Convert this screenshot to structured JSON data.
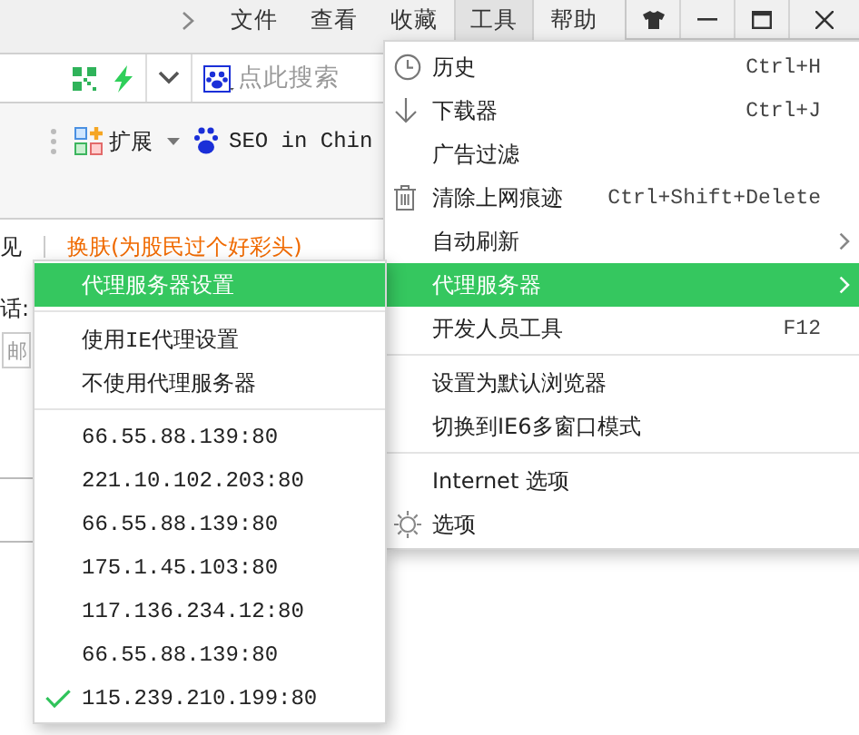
{
  "menu_bar": {
    "items": [
      {
        "label": "文件",
        "selected": false
      },
      {
        "label": "查看",
        "selected": false
      },
      {
        "label": "收藏",
        "selected": false
      },
      {
        "label": "工具",
        "selected": true
      },
      {
        "label": "帮助",
        "selected": false
      }
    ]
  },
  "address_bar": {
    "search_placeholder": "点此搜索"
  },
  "toolbar": {
    "items": [
      {
        "label": "扩展"
      },
      {
        "label": "SEO in Chin"
      }
    ]
  },
  "page": {
    "link": "换肤(为股民过个好彩头)",
    "texts": [
      "见",
      "话:"
    ],
    "field_value": "邮"
  },
  "tools_menu": {
    "items": [
      {
        "kind": "item",
        "label": "历史",
        "shortcut": "Ctrl+H",
        "selected": false
      },
      {
        "kind": "item",
        "label": "下载器",
        "shortcut": "Ctrl+J",
        "selected": false
      },
      {
        "kind": "item",
        "label": "广告过滤",
        "selected": false
      },
      {
        "kind": "item",
        "label": "清除上网痕迹",
        "shortcut": "Ctrl+Shift+Delete",
        "selected": false
      },
      {
        "kind": "item",
        "label": "自动刷新",
        "has_submenu": true,
        "selected": false
      },
      {
        "kind": "item",
        "label": "代理服务器",
        "has_submenu": true,
        "selected": true
      },
      {
        "kind": "item",
        "label": "开发人员工具",
        "shortcut": "F12",
        "selected": false
      },
      {
        "kind": "separator"
      },
      {
        "kind": "item",
        "label": "设置为默认浏览器",
        "selected": false
      },
      {
        "kind": "item",
        "label": "切换到IE6多窗口模式",
        "selected": false
      },
      {
        "kind": "separator"
      },
      {
        "kind": "item",
        "label": "Internet 选项",
        "selected": false
      },
      {
        "kind": "item",
        "label": "选项",
        "selected": false
      }
    ]
  },
  "proxy_submenu": {
    "items": [
      {
        "kind": "item",
        "label": "代理服务器设置",
        "selected": true,
        "checked": false
      },
      {
        "kind": "separator"
      },
      {
        "kind": "item",
        "label": "使用IE代理设置",
        "selected": false,
        "checked": false
      },
      {
        "kind": "item",
        "label": "不使用代理服务器",
        "selected": false,
        "checked": false
      },
      {
        "kind": "separator"
      },
      {
        "kind": "item",
        "label": "66.55.88.139:80",
        "selected": false,
        "checked": false
      },
      {
        "kind": "item",
        "label": "221.10.102.203:80",
        "selected": false,
        "checked": false
      },
      {
        "kind": "item",
        "label": "66.55.88.139:80",
        "selected": false,
        "checked": false
      },
      {
        "kind": "item",
        "label": "175.1.45.103:80",
        "selected": false,
        "checked": false
      },
      {
        "kind": "item",
        "label": "117.136.234.12:80",
        "selected": false,
        "checked": false
      },
      {
        "kind": "item",
        "label": "66.55.88.139:80",
        "selected": false,
        "checked": false
      },
      {
        "kind": "item",
        "label": "115.239.210.199:80",
        "selected": false,
        "checked": true
      }
    ]
  }
}
